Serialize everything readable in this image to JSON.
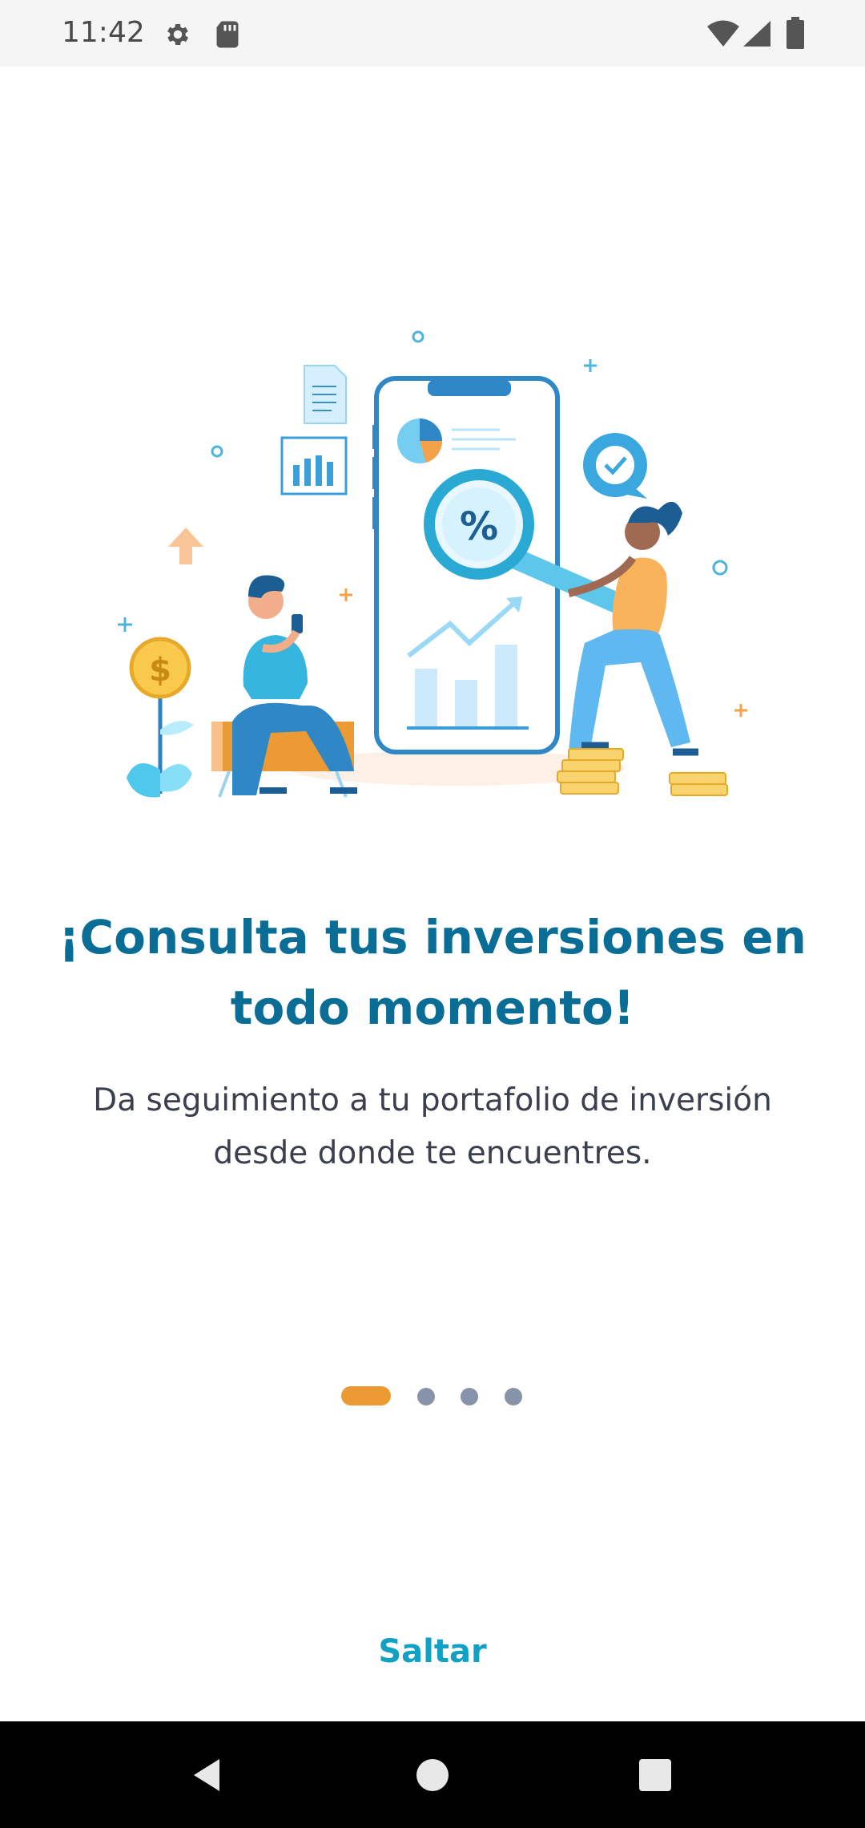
{
  "status_bar": {
    "time": "11:42",
    "icons": [
      "settings-icon",
      "sd-card-icon",
      "wifi-icon",
      "signal-icon",
      "battery-icon"
    ]
  },
  "onboarding": {
    "title": "¡Consulta tus inversiones en todo momento!",
    "subtitle": "Da seguimiento a tu portafolio de inversión desde donde te encuentres.",
    "illustration_icons": [
      "document-icon",
      "bar-chart-icon",
      "pie-chart-icon",
      "percent-magnifier-icon",
      "check-bubble-icon",
      "dollar-coin-icon",
      "arrow-up-icon",
      "coins-icon"
    ],
    "pages_total": 4,
    "current_page": 1
  },
  "actions": {
    "skip_label": "Saltar"
  },
  "navigation_bar": {
    "buttons": [
      "back",
      "home",
      "recents"
    ]
  },
  "colors": {
    "title": "#0a6d96",
    "subtitle": "#3b3f4e",
    "accent_orange": "#eb9a34",
    "inactive_dot": "#8693a8",
    "skip": "#11a1c4"
  }
}
